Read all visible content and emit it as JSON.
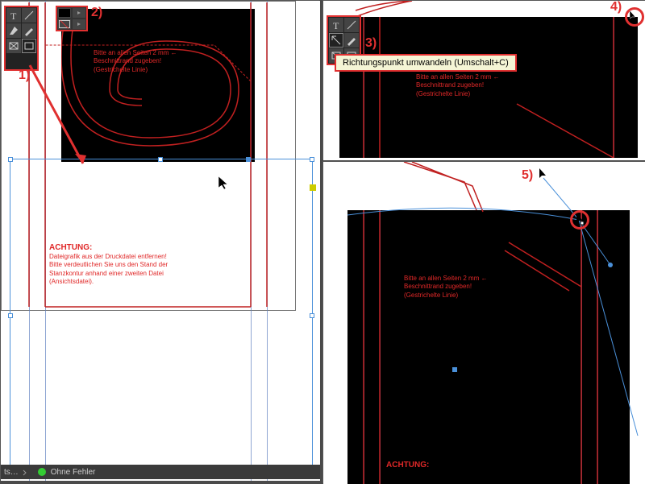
{
  "annotations": {
    "n1": "1)",
    "n2": "2)",
    "n3": "3)",
    "n4": "4)",
    "n5": "5)"
  },
  "tooltip": "Richtungspunkt umwandeln (Umschalt+C)",
  "warning_text": {
    "line1": "Bitte an allen Seiten 2 mm",
    "line2": "Beschnittrand zugeben!",
    "line3": "(Gestrichelte Linie)",
    "heading": "ACHTUNG:",
    "b1": "Dateigrafik aus der Druckdatei entfernen!",
    "b2": "Bitte verdeutlichen Sie uns den Stand der",
    "b3": "Stanzkontur anhand einer zweiten Datei",
    "b4": "(Ansichtsdatei)."
  },
  "statusbar": {
    "left": "ts…",
    "status": "Ohne Fehler"
  },
  "colors": {
    "red": "#e03030",
    "blue": "#4a90d9"
  }
}
